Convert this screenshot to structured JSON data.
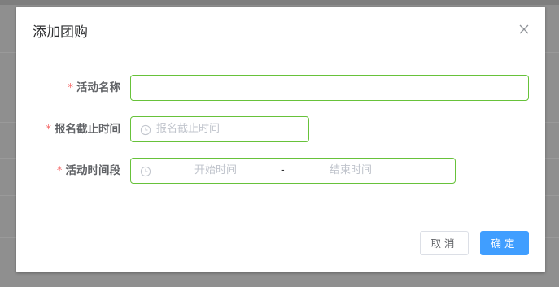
{
  "dialog": {
    "title": "添加团购",
    "close_icon": "close-icon"
  },
  "form": {
    "required_mark": "*",
    "activity_name": {
      "label": "活动名称",
      "value": "",
      "placeholder": ""
    },
    "signup_deadline": {
      "label": "报名截止时间",
      "placeholder": "报名截止时间",
      "icon": "clock-icon"
    },
    "activity_period": {
      "label": "活动时间段",
      "start_placeholder": "开始时间",
      "separator": "-",
      "end_placeholder": "结束时间",
      "icon": "clock-icon"
    }
  },
  "footer": {
    "cancel_label": "取消",
    "confirm_label": "确定"
  },
  "colors": {
    "valid_border": "#67c23a",
    "primary": "#409eff",
    "required": "#f56c6c"
  }
}
